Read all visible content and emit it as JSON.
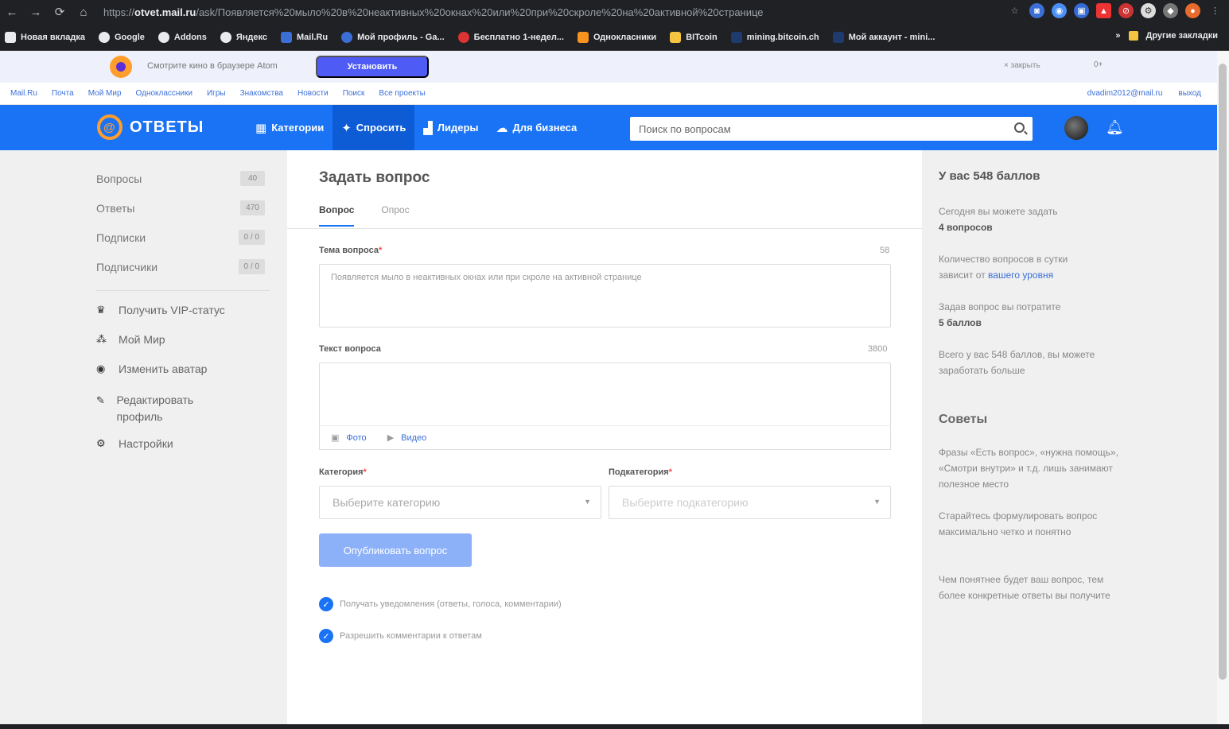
{
  "browser": {
    "url_prefix": "https://",
    "url_domain": "otvet.mail.ru",
    "url_path": "/ask/Появляется%20мыло%20в%20неактивных%20окнах%20или%20при%20скроле%20на%20активной%20странице",
    "bookmarks": [
      "Новая вкладка",
      "Google",
      "Addons",
      "Яндекс",
      "Mail.Ru",
      "Мой профиль - Ga...",
      "Бесплатно 1-недел...",
      "Однокласники",
      "BITcoin",
      "mining.bitcoin.ch",
      "Мой аккаунт - mini..."
    ],
    "other_bookmarks": "Другие закладки",
    "more": "»"
  },
  "promo": {
    "text": "Смотрите кино в браузере Atom",
    "install": "Установить",
    "close": "× закрыть",
    "age": "0+"
  },
  "portal": {
    "links": [
      "Mail.Ru",
      "Почта",
      "Мой Мир",
      "Одноклассники",
      "Игры",
      "Знакомства",
      "Новости",
      "Поиск",
      "Все проекты"
    ],
    "email": "dvadim2012@mail.ru",
    "logout": "выход"
  },
  "header": {
    "logo": "ОТВЕТЫ",
    "nav": [
      "Категории",
      "Спросить",
      "Лидеры",
      "Для бизнеса"
    ],
    "search_placeholder": "Поиск по вопросам"
  },
  "sidebar": {
    "stats": [
      {
        "label": "Вопросы",
        "value": "40"
      },
      {
        "label": "Ответы",
        "value": "470"
      },
      {
        "label": "Подписки",
        "value": "0 / 0"
      },
      {
        "label": "Подписчики",
        "value": "0 / 0"
      }
    ],
    "links": [
      "Получить VIP-статус",
      "Мой Мир",
      "Изменить аватар",
      "Редактировать профиль",
      "Настройки"
    ]
  },
  "main": {
    "title": "Задать вопрос",
    "tabs": [
      "Вопрос",
      "Опрос"
    ],
    "subject_label": "Тема вопроса",
    "subject_count": "58",
    "subject_value": "Появляется мыло в неактивных окнах или при скроле на активной странице",
    "text_label": "Текст вопроса",
    "text_count": "3800",
    "photo": "Фото",
    "video": "Видео",
    "category_label": "Категория",
    "category_placeholder": "Выберите категорию",
    "subcategory_label": "Подкатегория",
    "subcategory_placeholder": "Выберите подкатегорию",
    "publish": "Опубликовать вопрос",
    "notify": "Получать уведомления (ответы, голоса, комментарии)",
    "allow_comments": "Разрешить комментарии к ответам"
  },
  "right": {
    "title": "У вас 548 баллов",
    "p1a": "Сегодня вы можете задать",
    "p1b": "4 вопросов",
    "p2a": "Количество вопросов в сутки",
    "p2b": "зависит от",
    "p2link": "вашего уровня",
    "p3a": "Задав вопрос вы потратите",
    "p3b": "5 баллов",
    "p4": "Всего у вас 548 баллов, вы можете заработать больше",
    "tips_title": "Советы",
    "tip1": "Фразы «Есть вопрос», «нужна помощь», «Смотри внутри» и т.д. лишь занимают полезное место",
    "tip2": "Старайтесь формулировать вопрос максимально четко и понятно",
    "tip3": "Чем понятнее будет ваш вопрос, тем более конкретные ответы вы получите"
  }
}
